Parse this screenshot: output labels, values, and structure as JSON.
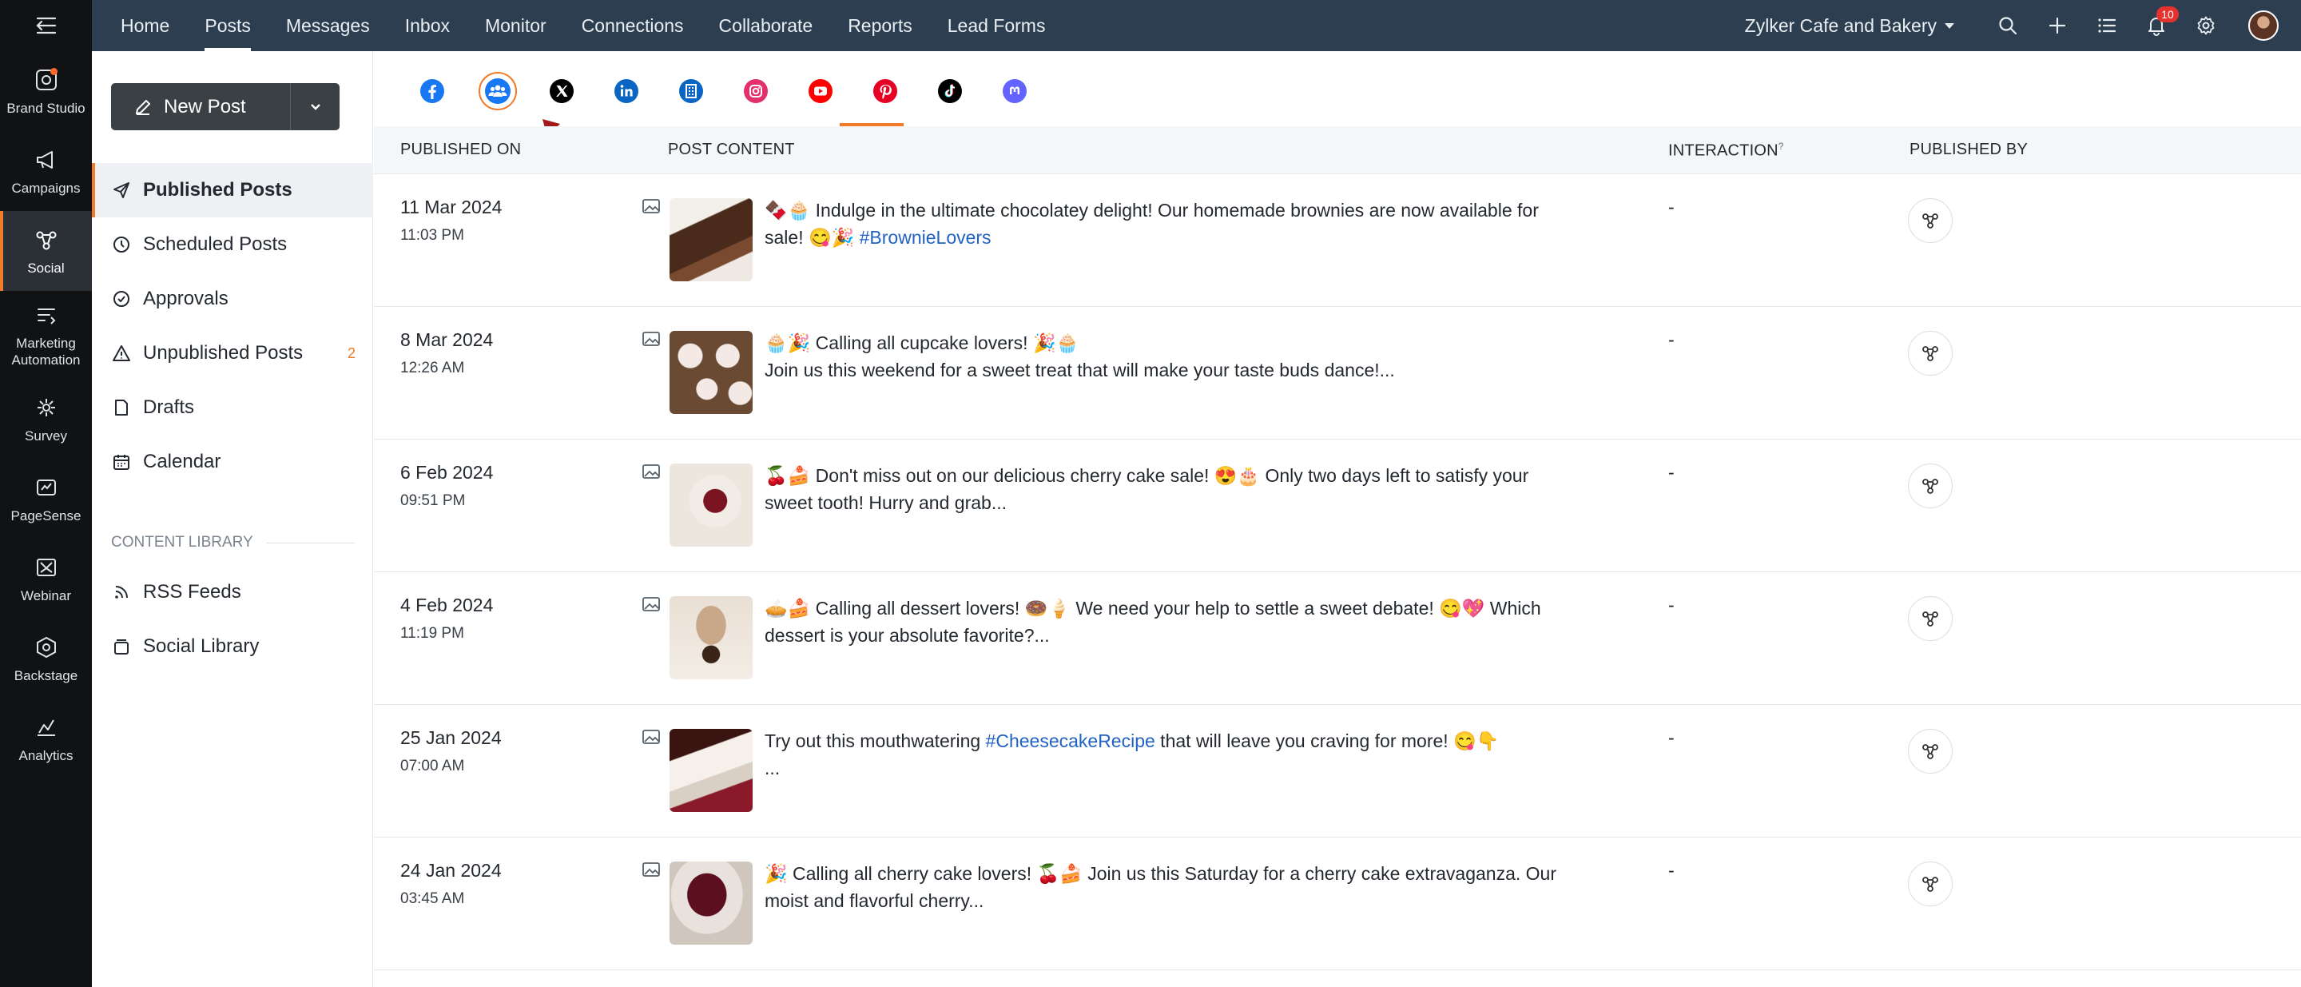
{
  "rail": {
    "items": [
      {
        "label": "Brand Studio",
        "icon": "brand-studio-icon"
      },
      {
        "label": "Campaigns",
        "icon": "megaphone-icon"
      },
      {
        "label": "Social",
        "icon": "social-share-icon"
      },
      {
        "label": "Marketing Automation",
        "icon": "automation-icon"
      },
      {
        "label": "Survey",
        "icon": "survey-icon"
      },
      {
        "label": "PageSense",
        "icon": "pagesense-icon"
      },
      {
        "label": "Webinar",
        "icon": "webinar-icon"
      },
      {
        "label": "Backstage",
        "icon": "backstage-icon"
      },
      {
        "label": "Analytics",
        "icon": "analytics-icon"
      }
    ],
    "active": "Social"
  },
  "topnav": {
    "tabs": [
      "Home",
      "Posts",
      "Messages",
      "Inbox",
      "Monitor",
      "Connections",
      "Collaborate",
      "Reports",
      "Lead Forms"
    ],
    "active": "Posts",
    "brand": "Zylker Cafe and Bakery",
    "notification_count": "10"
  },
  "sidebar": {
    "new_post_label": "New Post",
    "items": [
      {
        "label": "Published Posts",
        "icon": "paper-plane-icon"
      },
      {
        "label": "Scheduled Posts",
        "icon": "clock-icon"
      },
      {
        "label": "Approvals",
        "icon": "check-circle-icon"
      },
      {
        "label": "Unpublished Posts",
        "icon": "warning-icon",
        "count": "2"
      },
      {
        "label": "Drafts",
        "icon": "draft-file-icon"
      },
      {
        "label": "Calendar",
        "icon": "calendar-icon"
      }
    ],
    "section_label": "CONTENT LIBRARY",
    "library_items": [
      {
        "label": "RSS Feeds",
        "icon": "rss-icon"
      },
      {
        "label": "Social Library",
        "icon": "library-icon"
      }
    ]
  },
  "channels": [
    "Facebook",
    "Facebook Groups",
    "X",
    "LinkedIn",
    "LinkedIn Page",
    "Instagram",
    "YouTube",
    "Pinterest",
    "TikTok",
    "Mastodon"
  ],
  "table": {
    "headers": {
      "published_on": "PUBLISHED ON",
      "post_content": "POST CONTENT",
      "interaction": "INTERACTION",
      "interaction_note": "?",
      "published_by": "PUBLISHED BY"
    },
    "rows": [
      {
        "date": "11 Mar 2024",
        "time": "11:03 PM",
        "text": "🍫🧁 Indulge in the ultimate chocolatey delight! Our homemade brownies are now available for sale! 😋🎉",
        "hashtag": "#BrownieLovers",
        "text_after": "",
        "interaction": "-"
      },
      {
        "date": "8 Mar 2024",
        "time": "12:26 AM",
        "text": "🧁🎉 Calling all cupcake lovers! 🎉🧁\nJoin us this weekend for a sweet treat that will make your taste buds dance!...",
        "hashtag": "",
        "text_after": "",
        "interaction": "-"
      },
      {
        "date": "6 Feb 2024",
        "time": "09:51 PM",
        "text": "🍒🍰 Don't miss out on our delicious cherry cake sale! 😍🎂 Only two days left to satisfy your sweet tooth! Hurry and grab...",
        "hashtag": "",
        "text_after": "",
        "interaction": "-"
      },
      {
        "date": "4 Feb 2024",
        "time": "11:19 PM",
        "text": "🥧🍰 Calling all dessert lovers! 🍩🍦 We need your help to settle a sweet debate! 😋💖 Which dessert is your absolute favorite?...",
        "hashtag": "",
        "text_after": "",
        "interaction": "-"
      },
      {
        "date": "25 Jan 2024",
        "time": "07:00 AM",
        "text": "Try out this mouthwatering ",
        "hashtag": "#CheesecakeRecipe",
        "text_after": " that will leave you craving for more! 😋👇\n...",
        "interaction": "-"
      },
      {
        "date": "24 Jan 2024",
        "time": "03:45 AM",
        "text": "🎉 Calling all cherry cake lovers! 🍒🍰 Join us this Saturday for a cherry cake extravaganza. Our moist and flavorful cherry...",
        "hashtag": "",
        "text_after": "",
        "interaction": "-"
      }
    ]
  },
  "colors": {
    "accent": "#f07c2a",
    "topbar": "#2d3e50",
    "rail": "#101214",
    "link": "#2162c4"
  }
}
